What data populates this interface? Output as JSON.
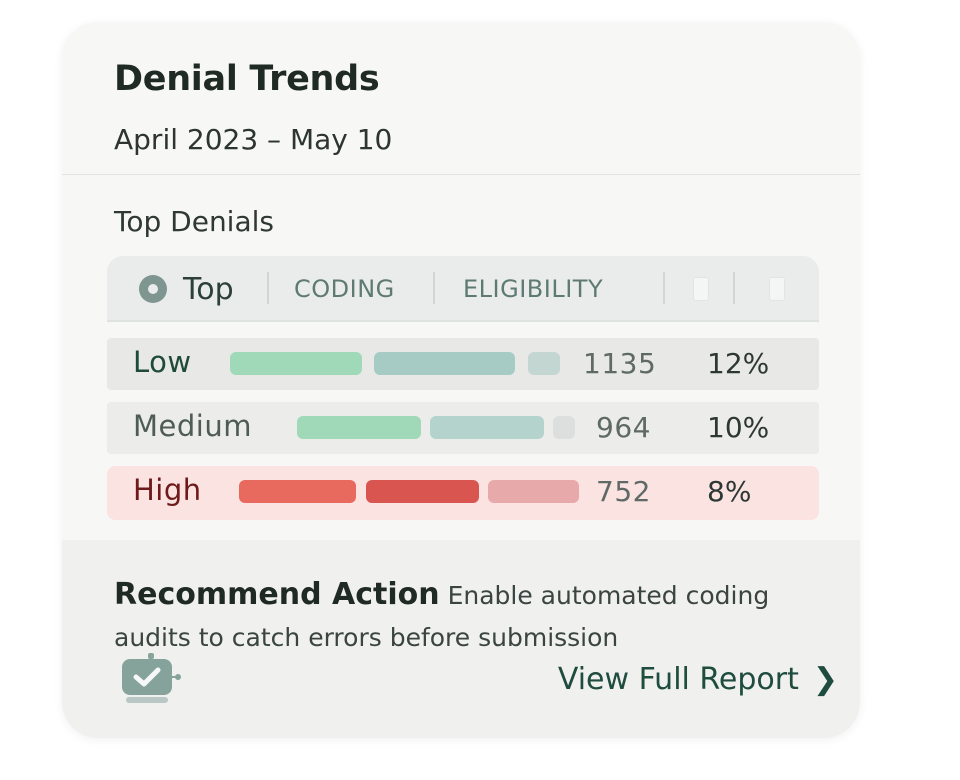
{
  "card": {
    "title": "Denial Trends",
    "date_range": "April 2023 – May 10"
  },
  "section": {
    "label": "Top Denials"
  },
  "filters": {
    "selected_label": "Top",
    "tabs": [
      "CODING",
      "ELIGIBILITY"
    ]
  },
  "rows": [
    {
      "label": "Low",
      "count": "1135",
      "percent": "12%"
    },
    {
      "label": "Medium",
      "count": "964",
      "percent": "10%"
    },
    {
      "label": "High",
      "count": "752",
      "percent": "8%"
    }
  ],
  "recommendation": {
    "title": "Recommend Action",
    "text": "Enable automated coding audits to catch errors before submission"
  },
  "link": {
    "label": "View Full Report"
  },
  "icons": {
    "filter_radio": "radio-selected-icon",
    "footer": "robot-check-icon",
    "link": "chevron-right-icon"
  },
  "colors": {
    "accent": "#1e4c3e",
    "low_bar_green": "#9fd9b7",
    "low_bar_teal": "#a6cbc5",
    "high_bar_red": "#e86a5e",
    "high_row_bg": "#fbe3e2"
  }
}
